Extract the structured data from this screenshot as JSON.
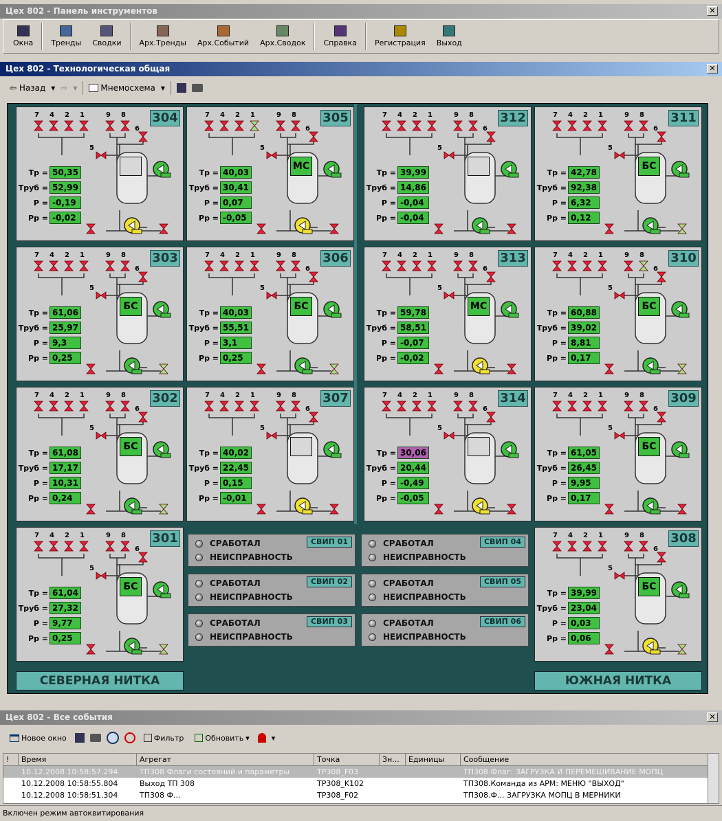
{
  "windows": {
    "toolbar_title": "Цех 802 - Панель инструментов",
    "main_title": "Цех 802 - Технологическая общая",
    "events_title": "Цех 802 - Все события",
    "close_glyph": "✕"
  },
  "toolbar": [
    {
      "label": "Окна",
      "icon": "windows-icon"
    },
    {
      "label": "Тренды",
      "icon": "trends-icon"
    },
    {
      "label": "Сводки",
      "icon": "summaries-icon"
    },
    {
      "label": "Арх.Тренды",
      "icon": "archive-trends-icon"
    },
    {
      "label": "Арх.Событий",
      "icon": "archive-events-icon"
    },
    {
      "label": "Арх.Сводок",
      "icon": "archive-summaries-icon"
    },
    {
      "label": "Справка",
      "icon": "help-icon"
    },
    {
      "label": "Регистрация",
      "icon": "register-icon"
    },
    {
      "label": "Выход",
      "icon": "exit-icon"
    }
  ],
  "nav": {
    "back": "⇦ Назад",
    "forward": "⇨",
    "mnemo": "Мнемосхема",
    "arrow": "▾"
  },
  "panels": [
    {
      "id": "304",
      "tr": "50,35",
      "trub": "52,99",
      "p": "-0,19",
      "pr": "-0,02",
      "tank": "",
      "alarm": false
    },
    {
      "id": "305",
      "tr": "40,03",
      "trub": "30,41",
      "p": "0,07",
      "pr": "-0,05",
      "tank": "МС",
      "alarm": false
    },
    {
      "id": "312",
      "tr": "39,99",
      "trub": "14,86",
      "p": "-0,04",
      "pr": "-0,04",
      "tank": "",
      "alarm": false
    },
    {
      "id": "311",
      "tr": "42,78",
      "trub": "92,38",
      "p": "6,32",
      "pr": "0,12",
      "tank": "БС",
      "alarm": false
    },
    {
      "id": "303",
      "tr": "61,06",
      "trub": "25,97",
      "p": "9,3",
      "pr": "0,25",
      "tank": "БС",
      "alarm": false
    },
    {
      "id": "306",
      "tr": "40,03",
      "trub": "55,51",
      "p": "3,1",
      "pr": "0,25",
      "tank": "БС",
      "alarm": false
    },
    {
      "id": "313",
      "tr": "59,78",
      "trub": "58,51",
      "p": "-0,07",
      "pr": "-0,02",
      "tank": "МС",
      "alarm": false
    },
    {
      "id": "310",
      "tr": "60,88",
      "trub": "39,02",
      "p": "8,81",
      "pr": "0,17",
      "tank": "БС",
      "alarm": false
    },
    {
      "id": "302",
      "tr": "61,08",
      "trub": "17,17",
      "p": "10,31",
      "pr": "0,24",
      "tank": "БС",
      "alarm": false
    },
    {
      "id": "307",
      "tr": "40,02",
      "trub": "22,45",
      "p": "0,15",
      "pr": "-0,01",
      "tank": "",
      "alarm": false
    },
    {
      "id": "314",
      "tr": "30,06",
      "trub": "20,44",
      "p": "-0,49",
      "pr": "-0,05",
      "tank": "",
      "alarm": true
    },
    {
      "id": "309",
      "tr": "61,05",
      "trub": "26,45",
      "p": "9,95",
      "pr": "0,17",
      "tank": "БС",
      "alarm": false
    },
    {
      "id": "301",
      "tr": "61,04",
      "trub": "27,32",
      "p": "9,77",
      "pr": "0,25",
      "tank": "БС",
      "alarm": false
    },
    {
      "id": "308",
      "tr": "39,99",
      "trub": "23,04",
      "p": "0,03",
      "pr": "0,06",
      "tank": "БС",
      "alarm": false
    }
  ],
  "labels": {
    "tr": "Тр =",
    "trub": "Труб =",
    "p": "Р =",
    "pr": "Рр =",
    "valve_nums": [
      "7",
      "4",
      "2",
      "1",
      "9",
      "8",
      "6",
      "5"
    ]
  },
  "svip": [
    {
      "name": "СВИП 01",
      "l1": "СРАБОТАЛ",
      "l2": "НЕИСПРАВНОСТЬ"
    },
    {
      "name": "СВИП 04",
      "l1": "СРАБОТАЛ",
      "l2": "НЕИСПРАВНОСТЬ"
    },
    {
      "name": "СВИП 02",
      "l1": "СРАБОТАЛ",
      "l2": "НЕИСПРАВНОСТЬ"
    },
    {
      "name": "СВИП 05",
      "l1": "СРАБОТАЛ",
      "l2": "НЕИСПРАВНОСТЬ"
    },
    {
      "name": "СВИП 03",
      "l1": "СРАБОТАЛ",
      "l2": "НЕИСПРАВНОСТЬ"
    },
    {
      "name": "СВИП 06",
      "l1": "СРАБОТАЛ",
      "l2": "НЕИСПРАВНОСТЬ"
    }
  ],
  "threads": {
    "north": "СЕВЕРНАЯ НИТКА",
    "south": "ЮЖНАЯ НИТКА"
  },
  "events_toolbar": {
    "new_window": "Новое окно",
    "filter": "Фильтр",
    "refresh": "Обновить"
  },
  "events_table": {
    "headers": [
      "!",
      "Время",
      "Агрегат",
      "Точка",
      "Зн...",
      "Единицы",
      "Сообщение"
    ],
    "rows": [
      [
        "",
        "10.12.2008 10:58:57.294",
        "ТП308 Флаги состояний и параметры",
        "ТР308_F03",
        "",
        "",
        "ТП308.Флаг: ЗАГРУЗКА И ПЕРЕМЕШИВАНИЕ МОПЦ"
      ],
      [
        "",
        "10.12.2008 10:58:55.804",
        "Выход ТП 308",
        "ТР308_K102",
        "",
        "",
        "ТП308.Команда из АРМ: МЕНЮ \"ВЫХОД\""
      ],
      [
        "",
        "10.12.2008 10:58:51.304",
        "ТП308 Ф...",
        "ТР308_F02",
        "",
        "",
        "ТП308.Ф... ЗАГРУЗКА МОПЦ В МЕРНИКИ"
      ]
    ]
  },
  "status": "Включен режим автоквитирования",
  "colors": {
    "valve_red": "#e0203c",
    "valve_green": "#9ee08a",
    "pump_green": "#40c040",
    "pump_yellow": "#f0e030",
    "tank": "#e8e8e8"
  }
}
